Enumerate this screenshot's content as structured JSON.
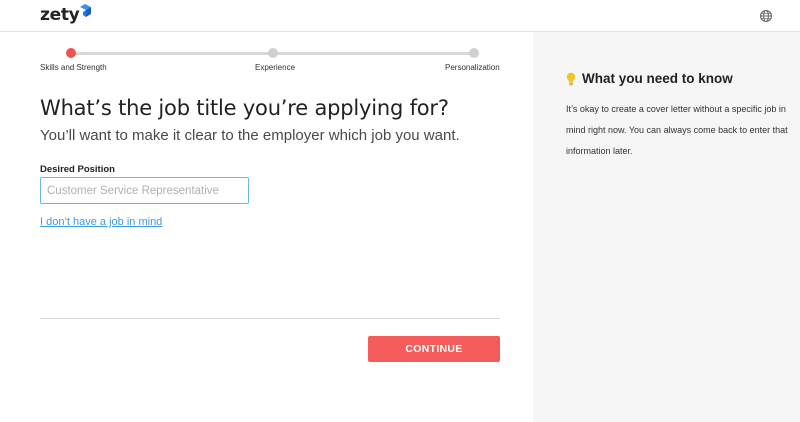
{
  "brand": {
    "logo_text": "zety"
  },
  "progress": {
    "steps": [
      {
        "label": "Skills and Strength",
        "active": true
      },
      {
        "label": "Experience",
        "active": false
      },
      {
        "label": "Personalization",
        "active": false
      }
    ]
  },
  "main": {
    "title": "What’s the job title you’re applying for?",
    "subtitle": "You’ll want to make it clear to the employer which job you want.",
    "field_label": "Desired Position",
    "field_value": "",
    "field_placeholder": "Customer Service Representative",
    "no_job_link": "I don’t have a job in mind",
    "continue_label": "CONTINUE"
  },
  "sidebar": {
    "title": "What you need to know",
    "body": "It’s okay to create a cover letter without a specific job in mind right now. You can always come back to enter that information later."
  },
  "colors": {
    "accent": "#f45b5b",
    "link": "#3d9ae0",
    "progress_active": "#ef5350",
    "sidebar_bg": "#f6f6f6",
    "logo_mark": "#1a73d9"
  },
  "icons": {
    "logo_mark": "cube-logo-icon",
    "language": "globe-icon",
    "tip": "lightbulb-icon"
  }
}
